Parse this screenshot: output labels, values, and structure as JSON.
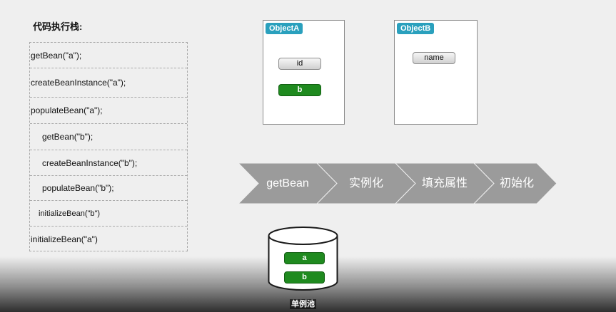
{
  "stack": {
    "title": "代码执行栈:",
    "rows": [
      "getBean(\"a\");",
      "createBeanInstance(\"a\");",
      "populateBean(\"a\");",
      "getBean(\"b\");",
      "createBeanInstance(\"b\");",
      "populateBean(\"b\");",
      "initializeBean(\"b\")",
      "initializeBean(\"a\")"
    ]
  },
  "objects": [
    {
      "name": "ObjectA",
      "fields": [
        {
          "label": "id",
          "style": "grey"
        },
        {
          "label": "b",
          "style": "green"
        }
      ]
    },
    {
      "name": "ObjectB",
      "fields": [
        {
          "label": "name",
          "style": "grey"
        }
      ]
    }
  ],
  "flow": {
    "steps": [
      "getBean",
      "实例化",
      "填充属性",
      "初始化"
    ],
    "color": "#9b9b9b"
  },
  "pool": {
    "caption": "单例池",
    "items": [
      "a",
      "b"
    ]
  },
  "colors": {
    "tag": "#2aa0bd",
    "green": "#1f8a1f",
    "arrow": "#9b9b9b"
  }
}
